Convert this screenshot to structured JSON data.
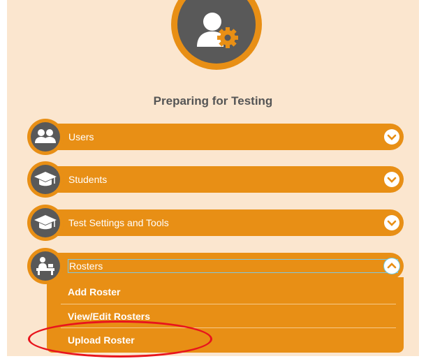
{
  "page": {
    "title": "Preparing for Testing"
  },
  "hero": {
    "icon": "user-settings-icon"
  },
  "sections": [
    {
      "label": "Users",
      "icon": "users-icon",
      "state": "collapsed"
    },
    {
      "label": "Students",
      "icon": "graduation-cap-icon",
      "state": "collapsed"
    },
    {
      "label": "Test Settings and Tools",
      "icon": "graduation-cap-icon",
      "state": "collapsed"
    },
    {
      "label": "Rosters",
      "icon": "teacher-desk-icon",
      "state": "expanded"
    }
  ],
  "rosters_menu": [
    {
      "label": "Add Roster"
    },
    {
      "label": "View/Edit Rosters"
    },
    {
      "label": "Upload Roster"
    }
  ],
  "colors": {
    "panel_bg": "#fbe6cf",
    "accent": "#e88f15",
    "icon_bg": "#595959",
    "highlight_outline": "#e8141d"
  }
}
